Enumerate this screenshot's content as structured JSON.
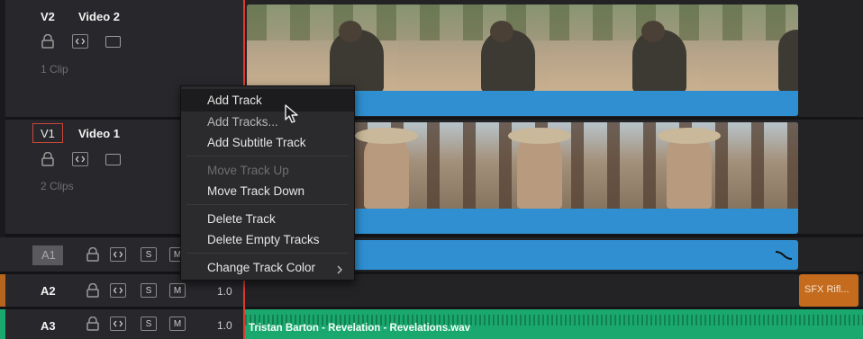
{
  "tracks": {
    "v2": {
      "id": "V2",
      "name": "Video 2",
      "clips": "1 Clip"
    },
    "v1": {
      "id": "V1",
      "name": "Video 1",
      "clips": "2 Clips"
    },
    "a1": {
      "id": "A1"
    },
    "a2": {
      "id": "A2",
      "volume": "1.0",
      "s": "S",
      "m": "M"
    },
    "a3": {
      "id": "A3",
      "volume": "1.0",
      "s": "S",
      "m": "M"
    }
  },
  "a1_buttons": {
    "s": "S",
    "m": "M"
  },
  "clips": {
    "a3_clip": "Tristan Barton - Revelation - Revelations.wav",
    "sfx_clip": "SFX Rifl..."
  },
  "menu": {
    "add_track": "Add Track",
    "add_tracks": "Add Tracks...",
    "add_subtitle": "Add Subtitle Track",
    "move_up": "Move Track Up",
    "move_down": "Move Track Down",
    "delete_track": "Delete Track",
    "delete_empty": "Delete Empty Tracks",
    "change_color": "Change Track Color"
  },
  "colors": {
    "video_clip": "#2f8fd0",
    "audio_clip": "#1aa86e",
    "sfx_clip": "#c46b1e",
    "playhead": "#e03a2f"
  }
}
